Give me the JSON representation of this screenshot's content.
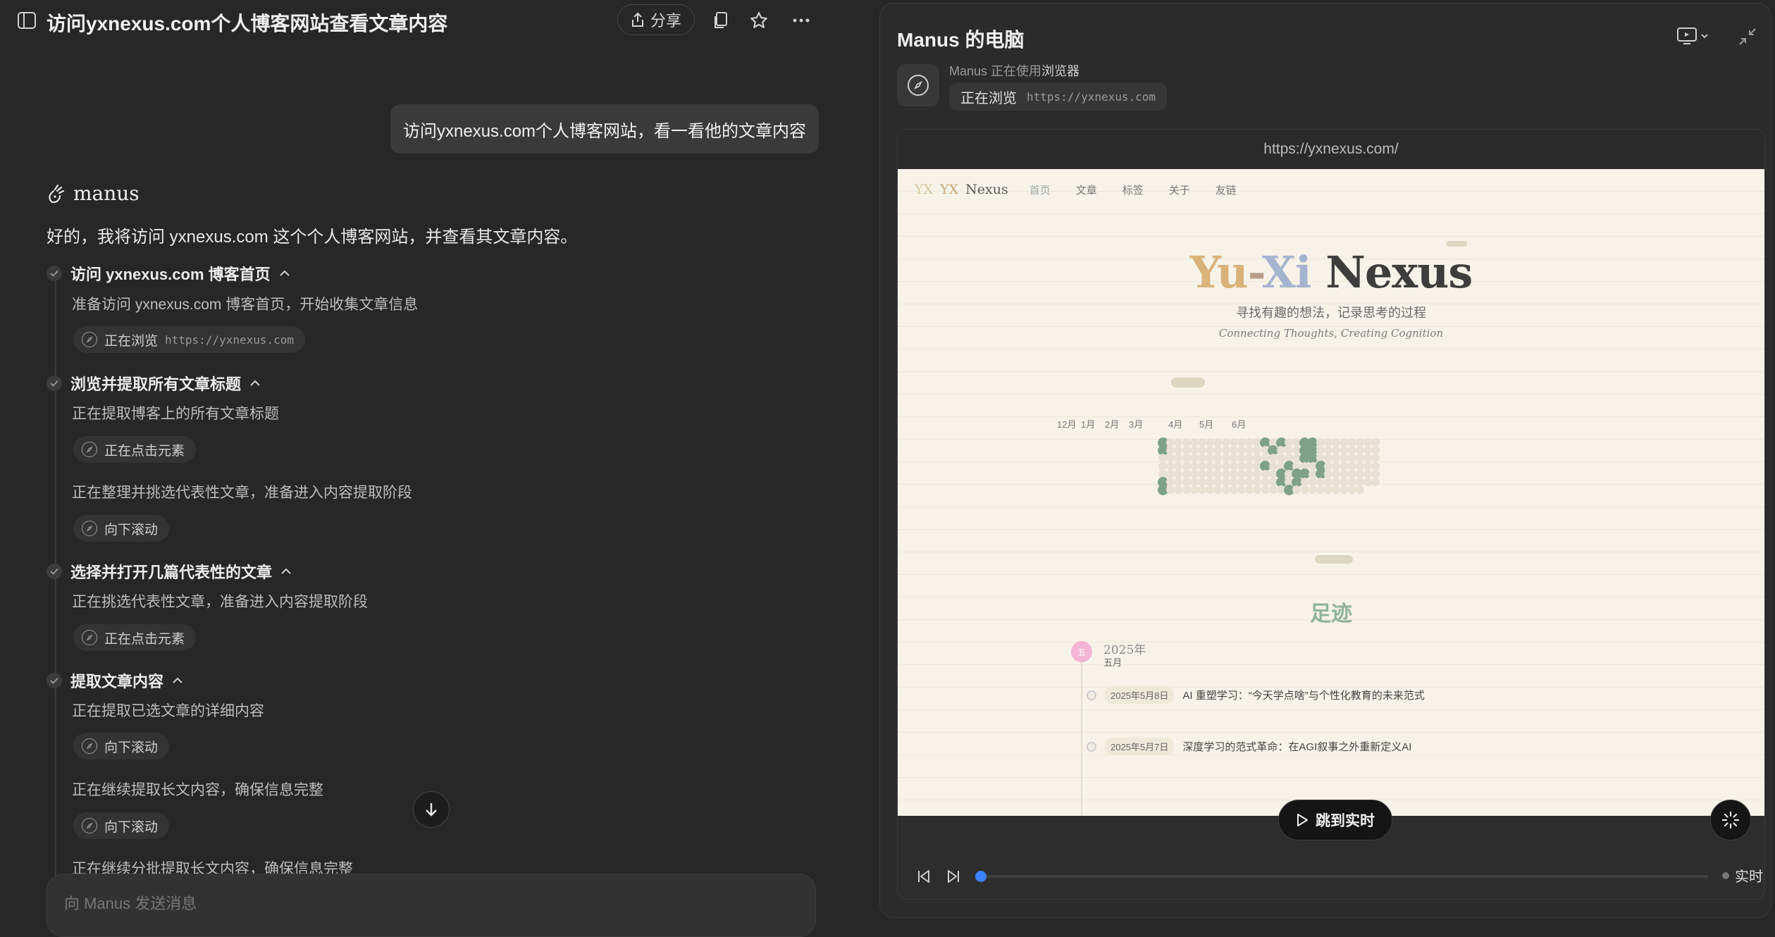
{
  "header": {
    "title": "访问yxnexus.com个人博客网站查看文章内容",
    "share_label": "分享"
  },
  "chat": {
    "user_message": "访问yxnexus.com个人博客网站，看一看他的文章内容",
    "assistant_name": "manus",
    "assistant_intro": "好的，我将访问 yxnexus.com 这个个人博客网站，并查看其文章内容。",
    "steps": [
      {
        "title": "访问 yxnexus.com 博客首页",
        "text1": "准备访问 yxnexus.com 博客首页，开始收集文章信息",
        "action1": "正在浏览",
        "action1_detail": "https://yxnexus.com"
      },
      {
        "title": "浏览并提取所有文章标题",
        "text1": "正在提取博客上的所有文章标题",
        "action1": "正在点击元素",
        "text2": "正在整理并挑选代表性文章，准备进入内容提取阶段",
        "action2": "向下滚动"
      },
      {
        "title": "选择并打开几篇代表性的文章",
        "text1": "正在挑选代表性文章，准备进入内容提取阶段",
        "action1": "正在点击元素"
      },
      {
        "title": "提取文章内容",
        "text1": "正在提取已选文章的详细内容",
        "action1": "向下滚动",
        "text2": "正在继续提取长文内容，确保信息完整",
        "action2": "向下滚动",
        "text3": "正在继续分批提取长文内容，确保信息完整"
      }
    ],
    "composer_placeholder": "向 Manus 发送消息"
  },
  "computer": {
    "title": "Manus 的电脑",
    "status_prefix": "Manus 正在使用",
    "status_tool": "浏览器",
    "browse_label": "正在浏览",
    "browse_url": "https://yxnexus.com",
    "address_bar": "https://yxnexus.com/",
    "jump_label": "跳到实时",
    "live_label": "实时",
    "playback_progress": 0.0
  },
  "site": {
    "logo_mark": "YX",
    "logo_yx": "YX",
    "logo_brand": "Nexus",
    "nav": [
      "首页",
      "文章",
      "标签",
      "关于",
      "友链"
    ],
    "hero_yu": "Yu",
    "hero_dash": "-",
    "hero_xi": "Xi",
    "hero_nexus": "Nexus",
    "subtitle_cn": "寻找有趣的想法，记录思考的过程",
    "subtitle_en": "Connecting Thoughts, Creating Cognition",
    "activity_months": [
      "12月",
      "1月",
      "2月",
      "3月",
      "4月",
      "5月",
      "6月"
    ],
    "footprint_title": "足迹",
    "year_badge": "五",
    "year": "2025年",
    "month": "五月",
    "entries": [
      {
        "date": "2025年5月8日",
        "title": "AI 重塑学习：“今天学点啥”与个性化教育的未来范式"
      },
      {
        "date": "2025年5月7日",
        "title": "深度学习的范式革命：在AGI叙事之外重新定义AI"
      }
    ]
  },
  "colors": {
    "accent_blue": "#3b82f6",
    "activity_green": "#7fa287",
    "footprint_green": "#8fb39a",
    "hero_gold": "#d9b27a",
    "hero_blue": "#a4b4cf"
  }
}
